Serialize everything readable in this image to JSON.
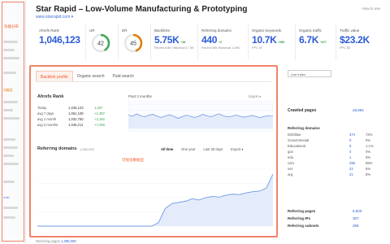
{
  "sidebar": {
    "brand": "",
    "note": "功能分布",
    "tags": [
      "功能区"
    ],
    "links": [
      "outh"
    ]
  },
  "header": {
    "title": "Star Rapid – Low-Volume Manufacturing & Prototyping",
    "url": "www.starrapid.com ▾",
    "howto": "How to use"
  },
  "metrics": [
    {
      "label": "Ahrefs Rank",
      "value": "1,046,123",
      "sub": "",
      "delta": ""
    },
    {
      "label": "UR",
      "value": "42",
      "sub": "",
      "delta": "",
      "gauge": 0.42,
      "color": "#3aa756"
    },
    {
      "label": "DR",
      "value": "45",
      "sub": "",
      "delta": "",
      "gauge": 0.45,
      "color": "#e07b00"
    },
    {
      "label": "Backlinks",
      "value": "5.75K",
      "sub": "Recent 8.8K  Historical 17.9K",
      "delta": "+36"
    },
    {
      "label": "Referring domains",
      "value": "440",
      "sub": "Recent 506  Historical 1.28K",
      "delta": "+2"
    },
    {
      "label": "Organic keywords",
      "value": "10.7K",
      "sub": "PPC 67",
      "delta": "+565"
    },
    {
      "label": "Organic traffic",
      "value": "6.7K",
      "sub": "",
      "delta": "+677"
    },
    {
      "label": "Traffic value",
      "value": "$23.2K",
      "sub": "PPC $0",
      "delta": ""
    }
  ],
  "tabs": [
    "Backlink profile",
    "Organic search",
    "Paid search"
  ],
  "rank": {
    "label": "Ahrefs Rank",
    "rows": [
      {
        "period": "Today",
        "value": "1,046,123",
        "delta": "1,257"
      },
      {
        "period": "avg 7 days",
        "value": "1,051,108",
        "delta": "+1,387"
      },
      {
        "period": "avg 1 month",
        "value": "1,032,760",
        "delta": "+3,192"
      },
      {
        "period": "avg 3 months",
        "value": "1,046,211",
        "delta": "+7,290"
      }
    ],
    "past_label": "Past 3 months",
    "export": "Export ▾"
  },
  "referring": {
    "label": "Referring domains",
    "count": "1,060,000",
    "filters": [
      "All time",
      "One year",
      "Last 30 days",
      "Export ▾"
    ],
    "note": "可视化数据显"
  },
  "right": {
    "select": "Live index",
    "crawled_label": "Crawled pages",
    "crawled_value": "29,894",
    "rd_label": "Referring domains",
    "rd_value": "440",
    "rows": [
      {
        "name": "Dofollow",
        "count": "374",
        "pct": "72%"
      },
      {
        "name": "Governmental",
        "count": "0",
        "pct": "0%"
      },
      {
        "name": "Educational",
        "count": "5",
        "pct": "1.1%"
      },
      {
        "name": "gov",
        "count": "0",
        "pct": "0%"
      },
      {
        "name": "edu",
        "count": "1",
        "pct": "0%"
      },
      {
        "name": "com",
        "count": "296",
        "pct": "66%"
      },
      {
        "name": "net",
        "count": "22",
        "pct": "5%"
      },
      {
        "name": "org",
        "count": "21",
        "pct": "5%"
      }
    ],
    "foot": [
      {
        "label": "Referring pages",
        "value": "5,840"
      },
      {
        "label": "Referring IPs",
        "value": "307"
      },
      {
        "label": "Referring subnets",
        "value": "259"
      }
    ]
  },
  "bottom": {
    "text": "Referring pages",
    "link": "1,305,000"
  },
  "chart_data": [
    {
      "type": "line",
      "title": "Ahrefs Rank",
      "x": [
        0,
        1,
        2,
        3,
        4,
        5,
        6,
        7,
        8,
        9,
        10,
        11,
        12,
        13,
        14,
        15,
        16,
        17,
        18,
        19,
        20,
        21,
        22,
        23,
        24,
        25,
        26,
        27,
        28,
        29,
        30,
        31,
        32,
        33,
        34,
        35
      ],
      "values": [
        0.55,
        0.5,
        0.6,
        0.52,
        0.48,
        0.55,
        0.58,
        0.5,
        0.45,
        0.52,
        0.56,
        0.5,
        0.42,
        0.48,
        0.55,
        0.5,
        0.45,
        0.5,
        0.58,
        0.52,
        0.48,
        0.55,
        0.6,
        0.52,
        0.48,
        0.5,
        0.55,
        0.5,
        0.46,
        0.5,
        0.54,
        0.48,
        0.45,
        0.5,
        0.52,
        0.5
      ],
      "ylim": [
        0,
        1
      ]
    },
    {
      "type": "area",
      "title": "Referring domains",
      "x": [
        0,
        1,
        2,
        3,
        4,
        5,
        6,
        7,
        8,
        9,
        10,
        11,
        12,
        13,
        14,
        15,
        16,
        17,
        18,
        19,
        20,
        21,
        22,
        23,
        24,
        25,
        26,
        27,
        28,
        29,
        30,
        31,
        32,
        33,
        34,
        35
      ],
      "values": [
        0,
        0,
        0,
        0,
        0,
        0,
        0,
        0,
        0,
        0,
        0,
        0,
        0,
        0,
        0,
        0,
        0,
        0,
        30,
        150,
        190,
        200,
        210,
        230,
        220,
        240,
        250,
        245,
        260,
        270,
        265,
        280,
        290,
        295,
        320,
        440
      ],
      "ylim": [
        0,
        480
      ]
    }
  ]
}
